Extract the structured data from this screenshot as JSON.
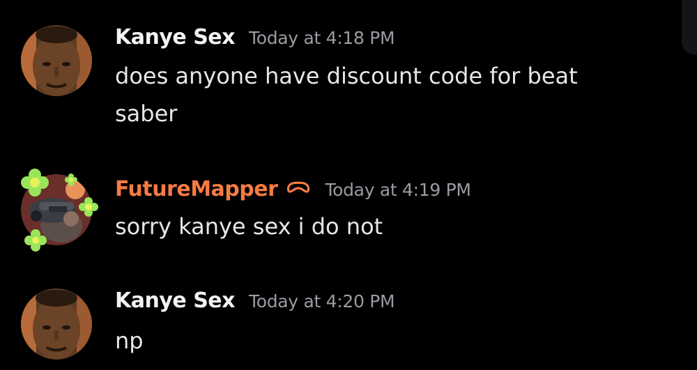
{
  "colors": {
    "background": "#000000",
    "username_default": "#f2f3f5",
    "username_accent": "#f47b43",
    "timestamp": "#9a9ca3",
    "message_text": "#e6e7ea"
  },
  "messages": [
    {
      "author": "Kanye Sex",
      "timestamp": "Today at 4:18 PM",
      "text": "does anyone have discount code for beat saber",
      "avatar_icon": "user-avatar-photo"
    },
    {
      "author": "FutureMapper",
      "timestamp": "Today at 4:19 PM",
      "text": "sorry kanye sex i do not",
      "avatar_icon": "user-avatar-with-flower-decoration",
      "badge_icon": "headset-badge-icon"
    },
    {
      "author": "Kanye Sex",
      "timestamp": "Today at 4:20 PM",
      "text": "np",
      "avatar_icon": "user-avatar-photo"
    }
  ]
}
